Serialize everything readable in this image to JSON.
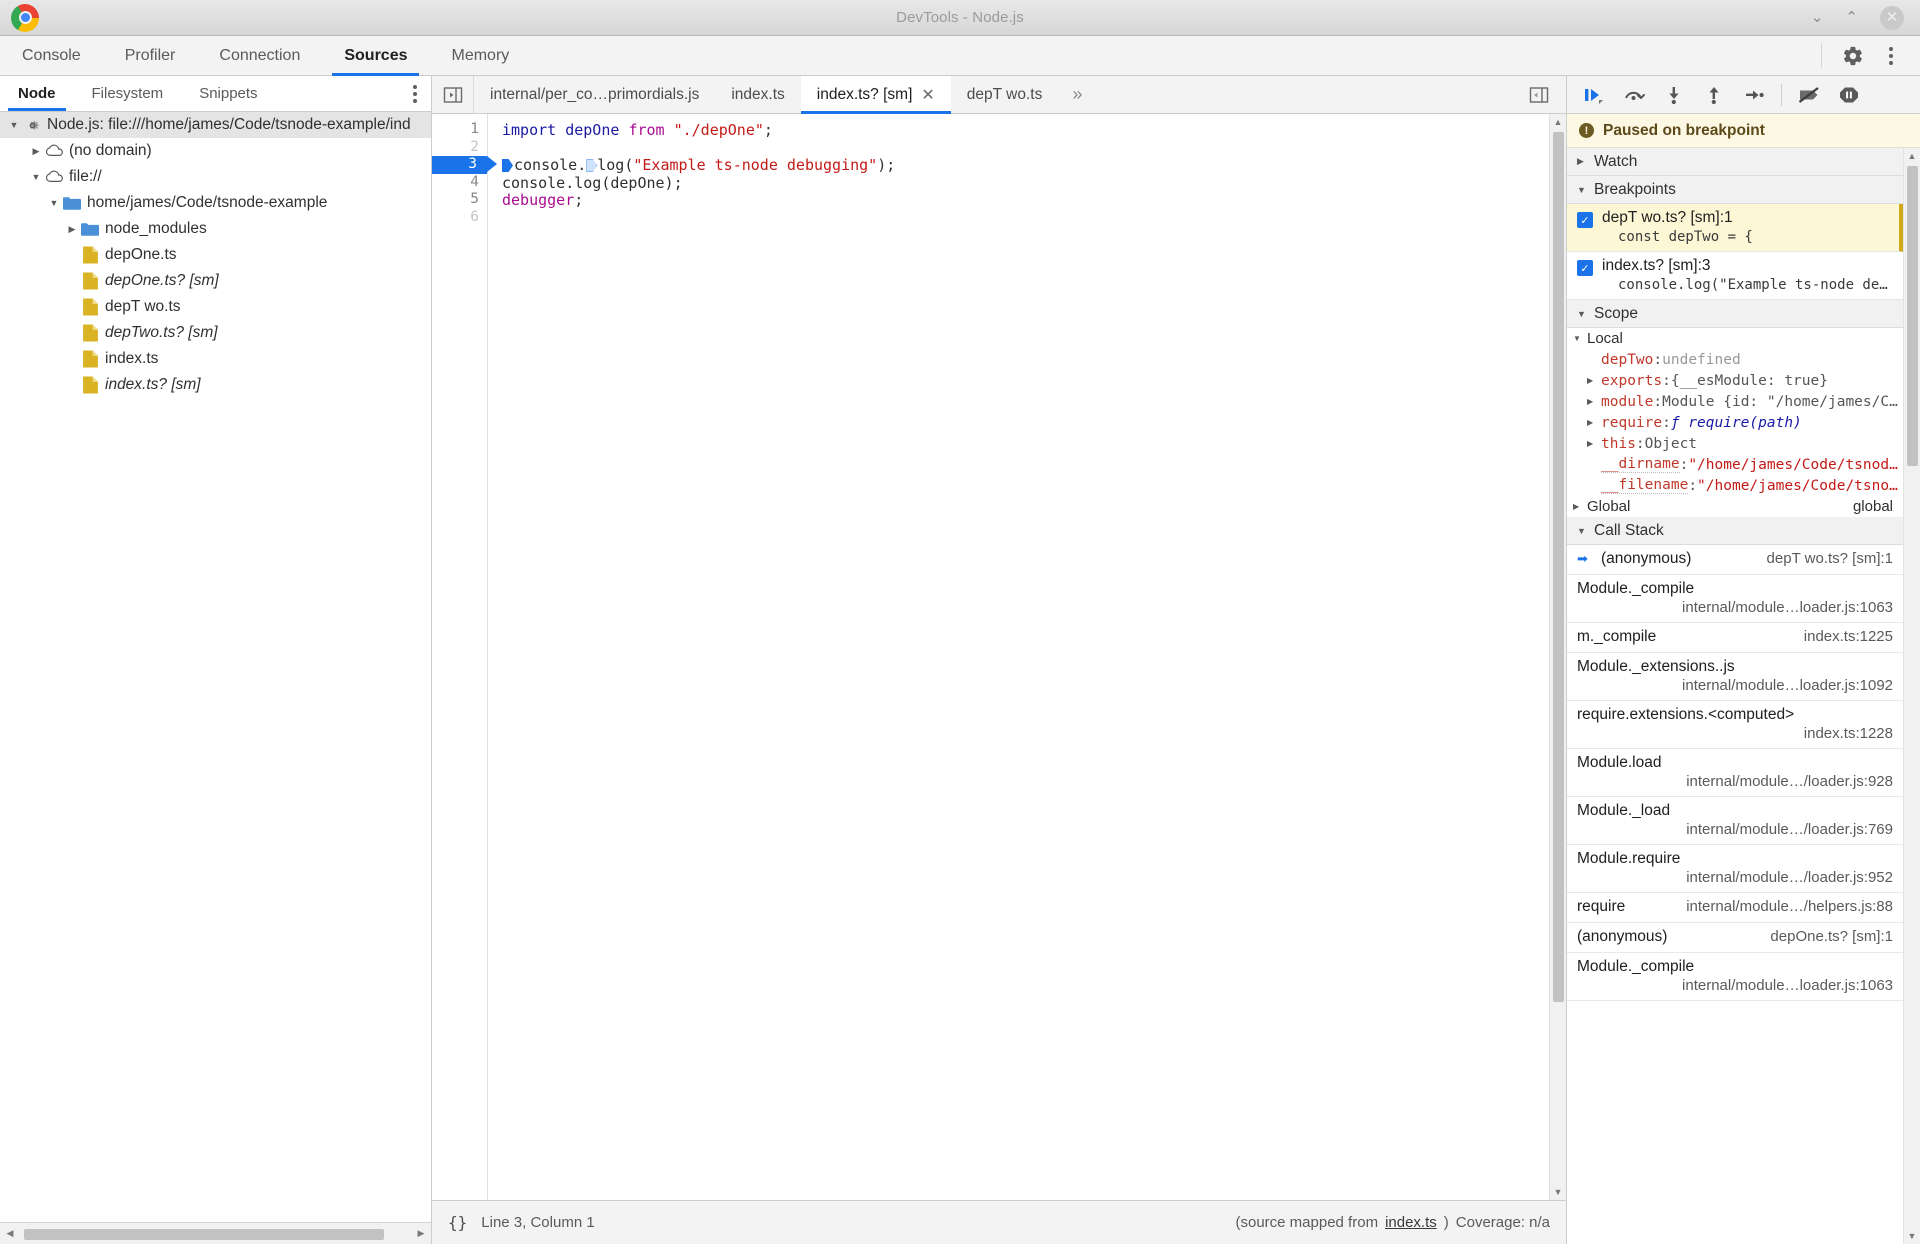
{
  "window": {
    "title": "DevTools - Node.js",
    "minimize": "⌄",
    "maximize": "⌃",
    "close": "✕"
  },
  "panel_tabs": [
    {
      "label": "Console",
      "active": false
    },
    {
      "label": "Profiler",
      "active": false
    },
    {
      "label": "Connection",
      "active": false
    },
    {
      "label": "Sources",
      "active": true
    },
    {
      "label": "Memory",
      "active": false
    }
  ],
  "panel_actions": {
    "settings": "gear-icon",
    "more": "kebab-icon"
  },
  "navigator": {
    "tabs": [
      {
        "label": "Node",
        "active": true
      },
      {
        "label": "Filesystem",
        "active": false
      },
      {
        "label": "Snippets",
        "active": false
      }
    ],
    "tree": [
      {
        "label": "Node.js: file:///home/james/Code/tsnode-example/ind",
        "icon": "node-gear-icon",
        "twisty": "▼",
        "indent": 0,
        "root": true,
        "sm": false
      },
      {
        "label": "(no domain)",
        "icon": "cloud-icon",
        "twisty": "▶",
        "indent": 1,
        "root": false,
        "sm": false
      },
      {
        "label": "file://",
        "icon": "cloud-icon",
        "twisty": "▼",
        "indent": 1,
        "root": false,
        "sm": false
      },
      {
        "label": "home/james/Code/tsnode-example",
        "icon": "folder-icon",
        "twisty": "▼",
        "indent": 2,
        "root": false,
        "sm": false
      },
      {
        "label": "node_modules",
        "icon": "folder-icon",
        "twisty": "▶",
        "indent": 3,
        "root": false,
        "sm": false
      },
      {
        "label": "depOne.ts",
        "icon": "file-icon",
        "twisty": "",
        "indent": 3,
        "root": false,
        "sm": false
      },
      {
        "label": "depOne.ts? [sm]",
        "icon": "file-icon",
        "twisty": "",
        "indent": 3,
        "root": false,
        "sm": true
      },
      {
        "label": "depT wo.ts",
        "icon": "file-icon",
        "twisty": "",
        "indent": 3,
        "root": false,
        "sm": false
      },
      {
        "label": "depTwo.ts? [sm]",
        "icon": "file-icon",
        "twisty": "",
        "indent": 3,
        "root": false,
        "sm": true
      },
      {
        "label": "index.ts",
        "icon": "file-icon",
        "twisty": "",
        "indent": 3,
        "root": false,
        "sm": false
      },
      {
        "label": "index.ts? [sm]",
        "icon": "file-icon",
        "twisty": "",
        "indent": 3,
        "root": false,
        "sm": true
      }
    ]
  },
  "editor": {
    "tabs": [
      {
        "label": "internal/per_co…primordials.js",
        "active": false,
        "closable": false
      },
      {
        "label": "index.ts",
        "active": false,
        "closable": false
      },
      {
        "label": "index.ts? [sm]",
        "active": true,
        "closable": true,
        "close": "✕"
      },
      {
        "label": "depT wo.ts",
        "active": false,
        "closable": false
      }
    ],
    "more": "»",
    "show_navigator_icon": "show-navigator-icon",
    "show_debugger_icon": "show-debugger-icon",
    "line_numbers": [
      "1",
      "2",
      "3",
      "4",
      "5",
      "6"
    ],
    "breakpoint_line": "3",
    "code_lines": [
      "import depOne from \"./depOne\";",
      "",
      "console.log(\"Example ts-node debugging\");",
      "console.log(depOne);",
      "debugger;",
      ""
    ]
  },
  "status_bar": {
    "format_icon": "{}",
    "cursor": "Line 3, Column 1",
    "source_mapped_prefix": "(source mapped from ",
    "source_mapped_link": "index.ts",
    "source_mapped_suffix": ")",
    "coverage": "Coverage: n/a"
  },
  "debugger": {
    "toolbar": [
      {
        "name": "resume-button",
        "icon": "resume-icon"
      },
      {
        "name": "step-over-button",
        "icon": "step-over-icon"
      },
      {
        "name": "step-into-button",
        "icon": "step-into-icon"
      },
      {
        "name": "step-out-button",
        "icon": "step-out-icon"
      },
      {
        "name": "step-button",
        "icon": "step-icon"
      },
      {
        "name": "deactivate-breakpoints-button",
        "icon": "deactivate-breakpoints-icon"
      },
      {
        "name": "pause-on-exceptions-button",
        "icon": "pause-on-exceptions-icon"
      }
    ],
    "paused_banner": "Paused on breakpoint",
    "sections": {
      "watch": {
        "label": "Watch",
        "caret": "▶"
      },
      "breakpoints": {
        "label": "Breakpoints",
        "caret": "▼"
      },
      "scope": {
        "label": "Scope",
        "caret": "▼"
      },
      "call_stack": {
        "label": "Call Stack",
        "caret": "▼"
      }
    },
    "breakpoints": [
      {
        "checked": "✓",
        "title": "depT wo.ts? [sm]:1",
        "snippet": "const depTwo = {",
        "hit": true
      },
      {
        "checked": "✓",
        "title": "index.ts? [sm]:3",
        "snippet": "console.log(\"Example ts-node deb…",
        "hit": false
      }
    ],
    "scope": {
      "local_label": "Local",
      "local_caret": "▼",
      "rows": [
        {
          "tri": "",
          "name": "depTwo",
          "sep": ": ",
          "value": "undefined",
          "vclass": "s-und",
          "underline": false
        },
        {
          "tri": "▶",
          "name": "exports",
          "sep": ": ",
          "value": "{__esModule: true}",
          "vclass": "s-obj",
          "underline": false
        },
        {
          "tri": "▶",
          "name": "module",
          "sep": ": ",
          "value": "Module {id: \"/home/james/C…",
          "vclass": "s-obj",
          "underline": false
        },
        {
          "tri": "▶",
          "name": "require",
          "sep": ": ",
          "value": "ƒ require(path)",
          "vclass": "s-fn",
          "underline": false
        },
        {
          "tri": "▶",
          "name": "this",
          "sep": ": ",
          "value": "Object",
          "vclass": "s-obj",
          "underline": false
        },
        {
          "tri": "",
          "name": "__dirname",
          "sep": ": ",
          "value": "\"/home/james/Code/tsnod…",
          "vclass": "s-str",
          "underline": true
        },
        {
          "tri": "",
          "name": "__filename",
          "sep": ": ",
          "value": "\"/home/james/Code/tsno…",
          "vclass": "s-str",
          "underline": true
        }
      ],
      "global_label": "Global",
      "global_caret": "▶",
      "global_value": "global"
    },
    "call_stack": [
      {
        "fn": "(anonymous)",
        "loc": "depT wo.ts? [sm]:1",
        "selected": true,
        "wrap": false
      },
      {
        "fn": "Module._compile",
        "loc": "internal/module…loader.js:1063",
        "selected": false,
        "wrap": true
      },
      {
        "fn": "m._compile",
        "loc": "index.ts:1225",
        "selected": false,
        "wrap": false
      },
      {
        "fn": "Module._extensions..js",
        "loc": "internal/module…loader.js:1092",
        "selected": false,
        "wrap": true
      },
      {
        "fn": "require.extensions.<computed>",
        "loc": "index.ts:1228",
        "selected": false,
        "wrap": true
      },
      {
        "fn": "Module.load",
        "loc": "internal/module…/loader.js:928",
        "selected": false,
        "wrap": true
      },
      {
        "fn": "Module._load",
        "loc": "internal/module…/loader.js:769",
        "selected": false,
        "wrap": true
      },
      {
        "fn": "Module.require",
        "loc": "internal/module…/loader.js:952",
        "selected": false,
        "wrap": true
      },
      {
        "fn": "require",
        "loc": "internal/module…/helpers.js:88",
        "selected": false,
        "wrap": false
      },
      {
        "fn": "(anonymous)",
        "loc": "depOne.ts? [sm]:1",
        "selected": false,
        "wrap": false
      },
      {
        "fn": "Module._compile",
        "loc": "internal/module…loader.js:1063",
        "selected": false,
        "wrap": true
      }
    ]
  },
  "colors": {
    "accent": "#1a73e8",
    "paused_bg": "#fdf8e3",
    "breakpoint_hit_bg": "#fdf7d5"
  }
}
